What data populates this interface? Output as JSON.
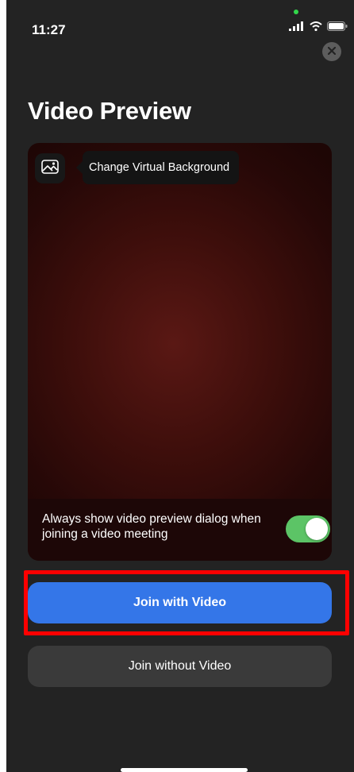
{
  "status_bar": {
    "time": "11:27",
    "icons": [
      "signal-icon",
      "wifi-icon",
      "battery-icon"
    ],
    "camera_in_use_color": "#32d74b"
  },
  "header": {
    "title": "Video Preview",
    "close_icon": "close-icon"
  },
  "preview": {
    "virtual_background": {
      "icon": "image-icon",
      "tooltip": "Change Virtual Background"
    },
    "setting": {
      "label": "Always show video preview dialog when joining a video meeting",
      "enabled": true,
      "toggle_color": "#5cc466"
    }
  },
  "actions": {
    "join_with_video": "Join with Video",
    "join_without_video": "Join without Video",
    "primary_color": "#3476e8",
    "highlight_color": "#ff0000"
  }
}
